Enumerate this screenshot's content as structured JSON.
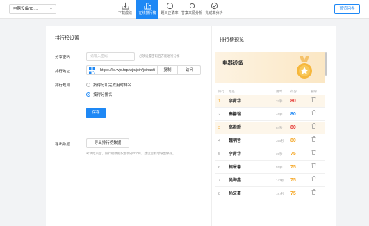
{
  "topbar": {
    "survey_select": "电器设备(ID:...",
    "nav": [
      {
        "label": "下载成绩",
        "icon": "download-icon"
      },
      {
        "label": "在线排行榜",
        "icon": "podium-icon",
        "active": true
      },
      {
        "label": "题目正确率",
        "icon": "pie-clock-icon"
      },
      {
        "label": "答案来源分析",
        "icon": "target-icon"
      },
      {
        "label": "完成率分析",
        "icon": "check-circle-icon"
      }
    ],
    "preview_button": "预览问卷"
  },
  "settings": {
    "title": "排行榜设置",
    "share_password_label": "分享密码",
    "password_placeholder": "请输入密码",
    "password_hint": "必须设置密码后方能进行分享",
    "link_label": "排行地址",
    "link_url": "https://ks.wjx.top/wjx/join/joinacti",
    "copy_button": "复制",
    "visit_button": "访问",
    "rule_label": "排行规则",
    "rule_options": [
      {
        "label": "按得分和完成用时排名",
        "selected": false
      },
      {
        "label": "按得分排名",
        "selected": true
      }
    ],
    "save_button": "保存",
    "export_label": "导出数据",
    "export_button": "导出排行榜数据",
    "export_hint": "考试结束后，排行榜数据仅会保存3个月，建议您及时导出保存。"
  },
  "preview": {
    "title": "排行榜预览",
    "head_title": "电器设备",
    "columns": {
      "rank": "排行",
      "name": "姓名",
      "time": "用时",
      "score": "得分",
      "delete": "删除"
    },
    "colors": {
      "accent": "#1e88f5",
      "gold": "#f5a623",
      "score_red": "#e53935",
      "score_blue": "#1e88f5",
      "score_orange": "#f5a623"
    },
    "rows": [
      {
        "rank": "1",
        "name": "李青华",
        "time": "37秒",
        "score": "80",
        "color": "#e53935"
      },
      {
        "rank": "2",
        "name": "秦善瑞",
        "time": "46秒",
        "score": "80",
        "color": "#1e88f5"
      },
      {
        "rank": "3",
        "name": "高君毅",
        "time": "84秒",
        "score": "80",
        "color": "#e53935"
      },
      {
        "rank": "4",
        "name": "魏明哲",
        "time": "355秒",
        "score": "80",
        "color": "#f5a623"
      },
      {
        "rank": "5",
        "name": "李青华",
        "time": "39秒",
        "score": "75",
        "color": "#f5a623"
      },
      {
        "rank": "6",
        "name": "褚米善",
        "time": "55秒",
        "score": "75",
        "color": "#f5a623"
      },
      {
        "rank": "7",
        "name": "吴海鑫",
        "time": "143秒",
        "score": "75",
        "color": "#f5a623"
      },
      {
        "rank": "8",
        "name": "杨文豪",
        "time": "187秒",
        "score": "75",
        "color": "#f5a623"
      }
    ]
  }
}
